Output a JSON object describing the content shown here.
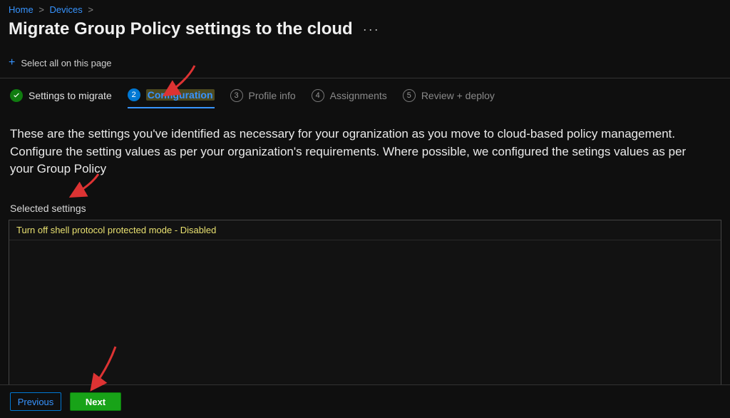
{
  "breadcrumbs": {
    "home": "Home",
    "devices": "Devices"
  },
  "page": {
    "title": "Migrate Group Policy settings to the cloud"
  },
  "toolbar": {
    "select_all": "Select all on this page"
  },
  "steps": {
    "s1": {
      "label": "Settings to migrate"
    },
    "s2": {
      "label": "Configuration",
      "num": "2"
    },
    "s3": {
      "label": "Profile info",
      "num": "3"
    },
    "s4": {
      "label": "Assignments",
      "num": "4"
    },
    "s5": {
      "label": "Review + deploy",
      "num": "5"
    }
  },
  "description": "These are the settings you've identified as necessary for your ogranization as you move to cloud-based policy management. Configure the setting values as per your organization's requirements. Where possible, we configured the setings values as per your Group Policy",
  "selected": {
    "label": "Selected settings",
    "items": [
      "Turn off shell protocol protected mode - Disabled"
    ]
  },
  "footer": {
    "previous": "Previous",
    "next": "Next"
  }
}
